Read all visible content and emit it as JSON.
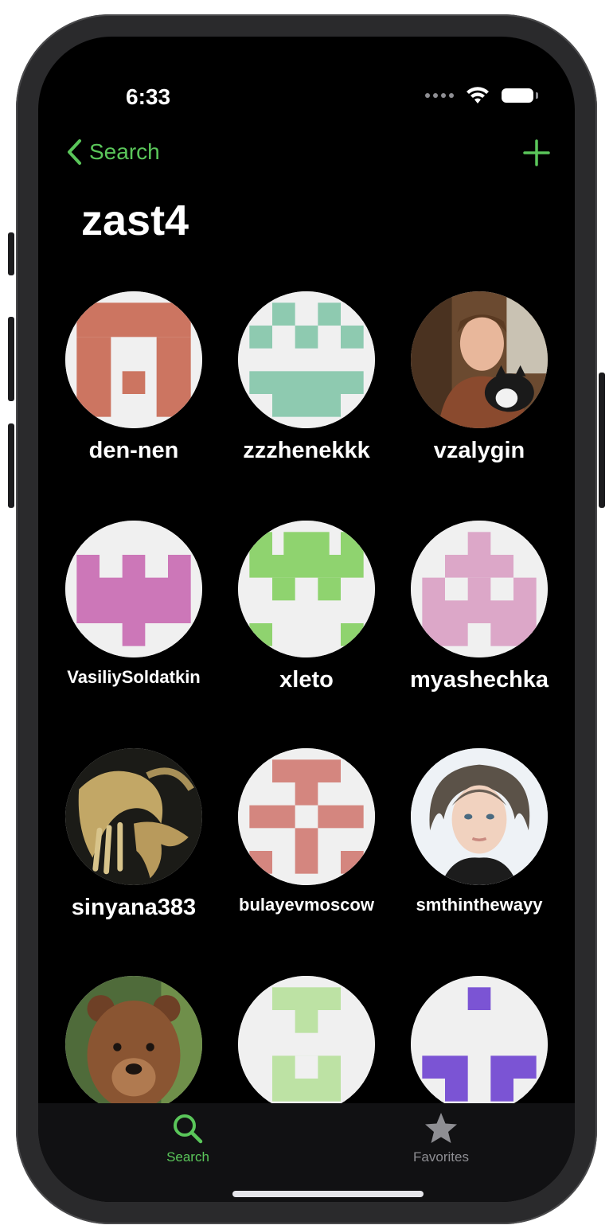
{
  "status_bar": {
    "time": "6:33"
  },
  "nav": {
    "back_label": "Search",
    "title": "zast4",
    "accent_color": "#5ac65a"
  },
  "users": [
    {
      "name": "den-nen",
      "avatar": "identicon-terracotta"
    },
    {
      "name": "zzzhenekkk",
      "avatar": "identicon-mint"
    },
    {
      "name": "vzalygin",
      "avatar": "photo-man-with-cat"
    },
    {
      "name": "VasiliySoldatkin",
      "avatar": "identicon-pink"
    },
    {
      "name": "xleto",
      "avatar": "identicon-green"
    },
    {
      "name": "myashechka",
      "avatar": "identicon-lilac"
    },
    {
      "name": "sinyana383",
      "avatar": "photo-gold-hands-artwork"
    },
    {
      "name": "bulayevmoscow",
      "avatar": "identicon-rose"
    },
    {
      "name": "smthinthewayy",
      "avatar": "photo-young-man-portrait"
    },
    {
      "name": "",
      "avatar": "photo-brown-bear"
    },
    {
      "name": "",
      "avatar": "identicon-light-green"
    },
    {
      "name": "",
      "avatar": "identicon-purple"
    }
  ],
  "tabbar": {
    "tabs": [
      {
        "label": "Search",
        "icon": "magnifier-icon",
        "active": true
      },
      {
        "label": "Favorites",
        "icon": "star-icon",
        "active": false
      }
    ]
  }
}
